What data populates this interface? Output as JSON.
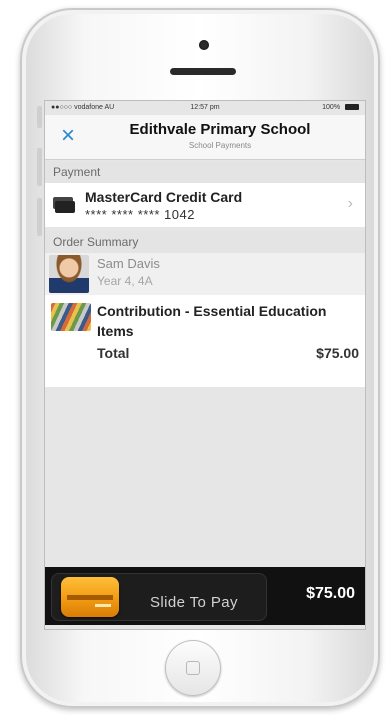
{
  "statusbar": {
    "carrier": "●●○○○ vodafone AU",
    "time": "12:57 pm",
    "battery": "100%"
  },
  "navbar": {
    "close_label": "×",
    "title": "Edithvale Primary School",
    "subtitle": "School Payments"
  },
  "payment": {
    "header": "Payment",
    "card_name": "MasterCard Credit Card",
    "card_number": "**** **** **** 1042",
    "chevron": "›"
  },
  "order": {
    "header": "Order Summary",
    "student_name": "Sam Davis",
    "student_class": "Year 4, 4A",
    "item_title": "Contribution - Essential Education Items",
    "total_label": "Total",
    "total_value": "$75.00"
  },
  "paybar": {
    "slide_label": "Slide To Pay",
    "amount": "$75.00"
  },
  "icons": {
    "close": "close-icon",
    "card": "credit-card-icon",
    "chevron": "chevron-right-icon",
    "home": "home-button-icon"
  },
  "colors": {
    "accent": "#2a8ad1",
    "slider_knob": "#f29a12",
    "paybar_bg": "#111111"
  }
}
